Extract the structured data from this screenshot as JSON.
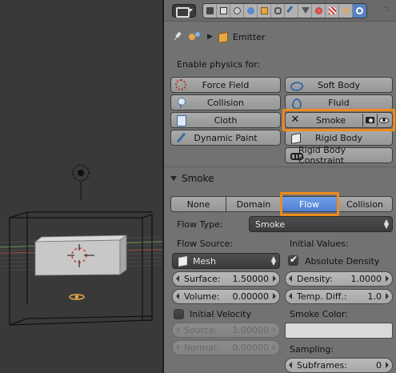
{
  "header": {
    "context_tabs": [
      "render",
      "render-layers",
      "scene",
      "world",
      "object",
      "constraints",
      "modifiers",
      "data",
      "material",
      "texture",
      "particles",
      "physics"
    ],
    "active_tab": "physics"
  },
  "breadcrumb": {
    "object_name": "Emitter"
  },
  "physics": {
    "enable_label": "Enable physics for:",
    "buttons": {
      "force_field": "Force Field",
      "collision": "Collision",
      "cloth": "Cloth",
      "dynamic_paint": "Dynamic Paint",
      "soft_body": "Soft Body",
      "fluid": "Fluid",
      "smoke": "Smoke",
      "rigid_body": "Rigid Body",
      "rigid_body_constraint": "Rigid Body Constraint"
    }
  },
  "smoke_panel": {
    "title": "Smoke",
    "types": [
      "None",
      "Domain",
      "Flow",
      "Collision"
    ],
    "active_type": "Flow",
    "flow_type_label": "Flow Type:",
    "flow_type_value": "Smoke",
    "flow_source_label": "Flow Source:",
    "flow_source_value": "Mesh",
    "surface_label": "Surface:",
    "surface_value": "1.50000",
    "volume_label": "Volume:",
    "volume_value": "0.00000",
    "initial_velocity_label": "Initial Velocity",
    "initial_velocity_checked": false,
    "source_label": "Source:",
    "source_value": "1.00000",
    "normal_label": "Normal:",
    "normal_value": "0.00000",
    "initial_values_label": "Initial Values:",
    "absolute_density_label": "Absolute Density",
    "absolute_density_checked": true,
    "density_label": "Density:",
    "density_value": "1.0000",
    "temp_diff_label": "Temp. Diff.:",
    "temp_diff_value": "1.0",
    "smoke_color_label": "Smoke Color:",
    "smoke_color": "#d9d9d9",
    "sampling_label": "Sampling:",
    "subframes_label": "Subframes:",
    "subframes_value": "0"
  },
  "colors": {
    "panel_bg": "#727272",
    "viewport_bg": "#393939",
    "active_blue": "#5680c2",
    "highlight_orange": "#f08a1c"
  }
}
